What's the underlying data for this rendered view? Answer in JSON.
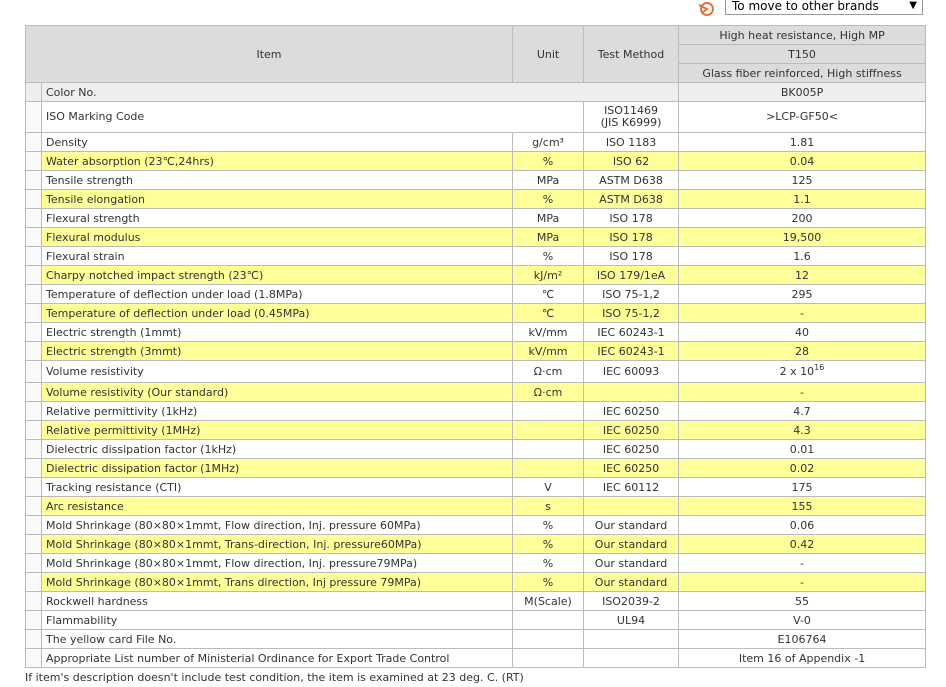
{
  "brand_select": {
    "value": "To move to other brands"
  },
  "header": {
    "item": "Item",
    "unit": "Unit",
    "test_method": "Test Method",
    "grade_desc": "High heat resistance, High MP",
    "grade": "T150",
    "grade_feature": "Glass fiber reinforced, High stiffness"
  },
  "color_row": {
    "label": "Color No.",
    "value": "BK005P"
  },
  "iso_row": {
    "label": "ISO Marking Code",
    "method_line1": "ISO11469",
    "method_line2": "(JIS K6999)",
    "value": ">LCP-GF50<"
  },
  "rows": [
    {
      "label": "Density",
      "unit": "g/cm³",
      "method": "ISO 1183",
      "value": "1.81",
      "yellow": false
    },
    {
      "label": "Water absorption (23℃,24hrs)",
      "unit": "%",
      "method": "ISO 62",
      "value": "0.04",
      "yellow": true
    },
    {
      "label": "Tensile strength",
      "unit": "MPa",
      "method": "ASTM D638",
      "value": "125",
      "yellow": false
    },
    {
      "label": "Tensile elongation",
      "unit": "%",
      "method": "ASTM D638",
      "value": "1.1",
      "yellow": true
    },
    {
      "label": "Flexural strength",
      "unit": "MPa",
      "method": "ISO 178",
      "value": "200",
      "yellow": false
    },
    {
      "label": "Flexural modulus",
      "unit": "MPa",
      "method": "ISO 178",
      "value": "19,500",
      "yellow": true
    },
    {
      "label": "Flexural strain",
      "unit": "%",
      "method": "ISO 178",
      "value": "1.6",
      "yellow": false
    },
    {
      "label": "Charpy notched impact strength (23℃)",
      "unit": "kJ/m²",
      "method": "ISO 179/1eA",
      "value": "12",
      "yellow": true
    },
    {
      "label": "Temperature of deflection under load (1.8MPa)",
      "unit": "℃",
      "method": "ISO 75-1,2",
      "value": "295",
      "yellow": false
    },
    {
      "label": "Temperature of deflection under load (0.45MPa)",
      "unit": "℃",
      "method": "ISO 75-1,2",
      "value": "-",
      "yellow": true
    },
    {
      "label": "Electric strength (1mmt)",
      "unit": "kV/mm",
      "method": "IEC 60243-1",
      "value": "40",
      "yellow": false
    },
    {
      "label": "Electric strength (3mmt)",
      "unit": "kV/mm",
      "method": "IEC 60243-1",
      "value": "28",
      "yellow": true
    }
  ],
  "volume_row": {
    "label": "Volume resistivity",
    "unit": "Ω·cm",
    "method": "IEC 60093",
    "value_base": "2 x 10",
    "value_exp": "16"
  },
  "rows2": [
    {
      "label": "Volume resistivity (Our standard)",
      "unit": "Ω·cm",
      "method": "",
      "value": "-",
      "yellow": true
    },
    {
      "label": "Relative permittivity (1kHz)",
      "unit": "",
      "method": "IEC 60250",
      "value": "4.7",
      "yellow": false
    },
    {
      "label": "Relative permittivity (1MHz)",
      "unit": "",
      "method": "IEC 60250",
      "value": "4.3",
      "yellow": true
    },
    {
      "label": "Dielectric dissipation factor (1kHz)",
      "unit": "",
      "method": "IEC 60250",
      "value": "0.01",
      "yellow": false
    },
    {
      "label": "Dielectric dissipation factor (1MHz)",
      "unit": "",
      "method": "IEC 60250",
      "value": "0.02",
      "yellow": true
    },
    {
      "label": "Tracking resistance (CTI)",
      "unit": "V",
      "method": "IEC 60112",
      "value": "175",
      "yellow": false
    },
    {
      "label": "Arc resistance",
      "unit": "s",
      "method": "",
      "value": "155",
      "yellow": true
    },
    {
      "label": "Mold Shrinkage (80×80×1mmt, Flow direction, Inj. pressure 60MPa)",
      "unit": "%",
      "method": "Our standard",
      "value": "0.06",
      "yellow": false
    },
    {
      "label": "Mold Shrinkage (80×80×1mmt, Trans-direction, Inj. pressure60MPa)",
      "unit": "%",
      "method": "Our standard",
      "value": "0.42",
      "yellow": true
    },
    {
      "label": "Mold Shrinkage (80×80×1mmt, Flow direction, Inj. pressure79MPa)",
      "unit": "%",
      "method": "Our standard",
      "value": "-",
      "yellow": false
    },
    {
      "label": "Mold Shrinkage (80×80×1mmt, Trans direction, Inj pressure 79MPa)",
      "unit": "%",
      "method": "Our standard",
      "value": "-",
      "yellow": true
    },
    {
      "label": "Rockwell hardness",
      "unit": "M(Scale)",
      "method": "ISO2039-2",
      "value": "55",
      "yellow": false
    },
    {
      "label": "Flammability",
      "unit": "",
      "method": "UL94",
      "value": "V-0",
      "yellow": false
    },
    {
      "label": "The yellow card File No.",
      "unit": "",
      "method": "",
      "value": "E106764",
      "yellow": false
    },
    {
      "label": "Appropriate List number of Ministerial Ordinance for Export Trade Control",
      "unit": "",
      "method": "",
      "value": "Item 16 of Appendix -1",
      "yellow": false
    }
  ],
  "footnote": "If item's description doesn't include test condition, the item is examined at 23 deg. C. (RT)"
}
